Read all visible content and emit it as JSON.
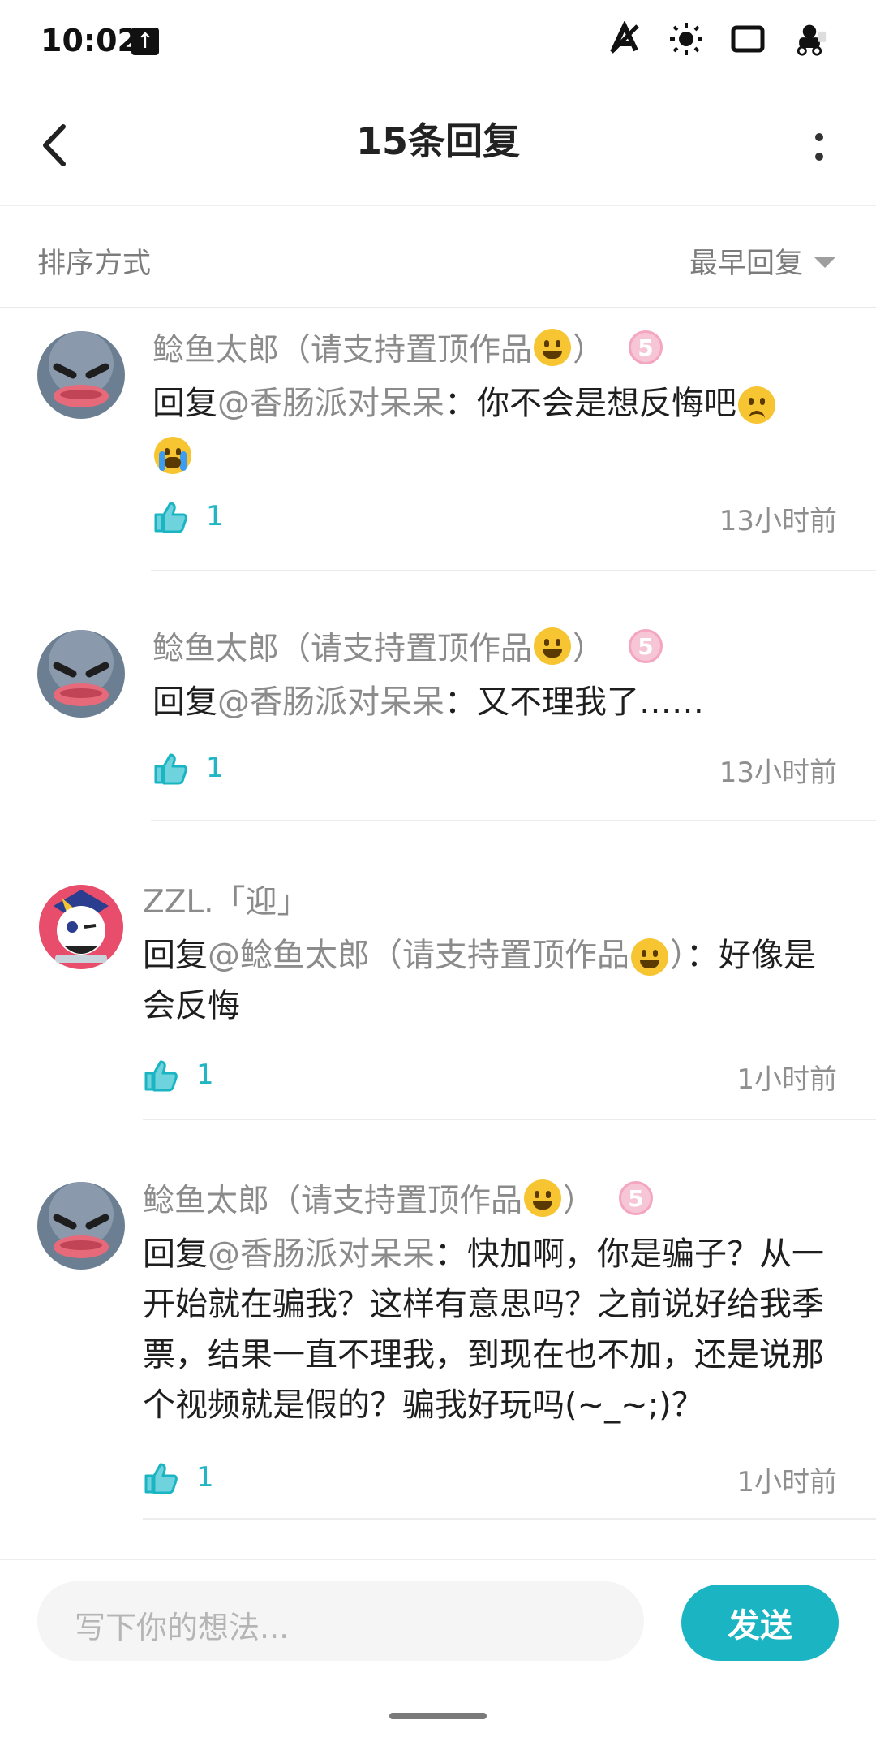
{
  "status": {
    "time": "10:02"
  },
  "header": {
    "title": "15条回复"
  },
  "sort": {
    "label": "排序方式",
    "value": "最早回复"
  },
  "comments": [
    {
      "name": "鲶鱼太郎（请支持置顶作品",
      "name_tail": "）",
      "level": "5",
      "reply_prefix": "回复",
      "mention": "@香肠派对呆呆",
      "text": "：你不会是想反悔吧",
      "likes": "1",
      "time": "13小时前"
    },
    {
      "name": "鲶鱼太郎（请支持置顶作品",
      "name_tail": "）",
      "level": "5",
      "reply_prefix": "回复",
      "mention": "@香肠派对呆呆",
      "text": "：又不理我了……",
      "likes": "1",
      "time": "13小时前"
    },
    {
      "name": "ZZL.「迎」",
      "reply_prefix": "回复",
      "mention": "@鲶鱼太郎（请支持置顶作品",
      "mention_tail": "）",
      "text": "：好像是会反悔",
      "likes": "1",
      "time": "1小时前"
    },
    {
      "name": "鲶鱼太郎（请支持置顶作品",
      "name_tail": "）",
      "level": "5",
      "reply_prefix": "回复",
      "mention": "@香肠派对呆呆",
      "text": "：快加啊，你是骗子？从一开始就在骗我？这样有意思吗？之前说好给我季票，结果一直不理我，到现在也不加，还是说那个视频就是假的？骗我好玩吗(~_~;)？",
      "likes": "1",
      "time": "1小时前"
    }
  ],
  "input": {
    "placeholder": "写下你的想法..."
  },
  "send": {
    "label": "发送"
  },
  "colors": {
    "accent": "#1ab4c2",
    "muted": "#8b8b8b"
  }
}
